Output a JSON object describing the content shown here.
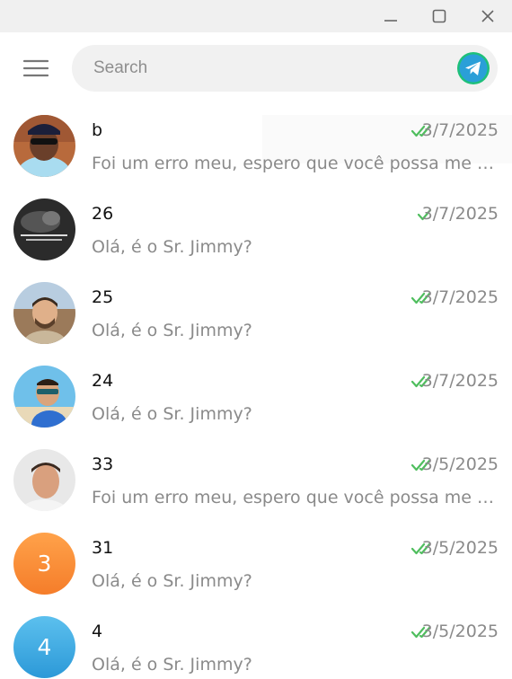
{
  "window": {
    "minimize_icon": "minimize-icon",
    "maximize_icon": "maximize-icon",
    "close_icon": "close-icon"
  },
  "header": {
    "menu_icon": "hamburger-menu-icon",
    "search": {
      "placeholder": "Search",
      "value": ""
    },
    "logo_icon": "telegram-logo-icon",
    "accent": "#2a9fd8"
  },
  "colors": {
    "check": "#4fbe5e",
    "date": "#8a8a8a",
    "preview": "#8a8a8a"
  },
  "chats": [
    {
      "name": "b",
      "date": "3/7/2025",
      "preview": "Foi um erro meu, espero que você possa me perdoar",
      "status": "read",
      "avatar": "photo"
    },
    {
      "name": "26",
      "date": "3/7/2025",
      "preview": "Olá, é o Sr. Jimmy?",
      "status": "delivered",
      "avatar": "photo"
    },
    {
      "name": "25",
      "date": "3/7/2025",
      "preview": "Olá, é o Sr. Jimmy?",
      "status": "read",
      "avatar": "photo"
    },
    {
      "name": "24",
      "date": "3/7/2025",
      "preview": "Olá, é o Sr. Jimmy?",
      "status": "read",
      "avatar": "photo"
    },
    {
      "name": "33",
      "date": "3/5/2025",
      "preview": "Foi um erro meu, espero que você possa me perdoar",
      "status": "read",
      "avatar": "photo"
    },
    {
      "name": "31",
      "date": "3/5/2025",
      "preview": "Olá, é o Sr. Jimmy?",
      "status": "read",
      "avatar": "letter",
      "avatar_text": "3",
      "avatar_color": "#f68b2f"
    },
    {
      "name": "4",
      "date": "3/5/2025",
      "preview": "Olá, é o Sr. Jimmy?",
      "status": "read",
      "avatar": "letter",
      "avatar_text": "4",
      "avatar_color": "#3aa8e0"
    }
  ]
}
